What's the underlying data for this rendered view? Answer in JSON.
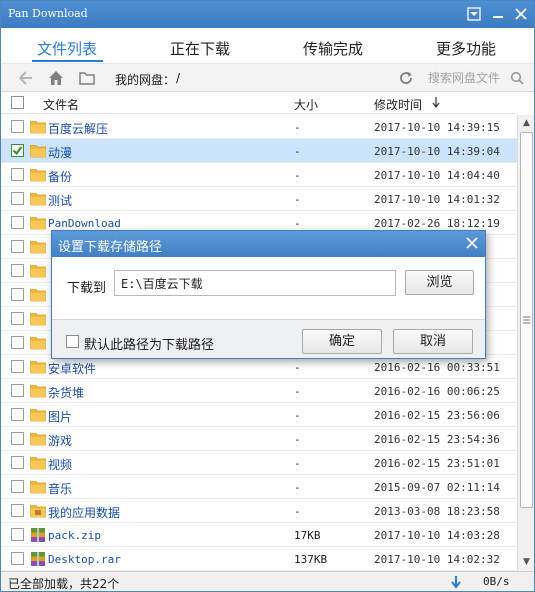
{
  "window": {
    "title": "Pan Download"
  },
  "tabs": [
    {
      "label": "文件列表",
      "active": true
    },
    {
      "label": "正在下载",
      "active": false
    },
    {
      "label": "传输完成",
      "active": false
    },
    {
      "label": "更多功能",
      "active": false
    }
  ],
  "toolbar": {
    "path_label": "我的网盘：",
    "path_value": "/",
    "search_placeholder": "搜索网盘文件"
  },
  "header": {
    "name": "文件名",
    "size": "大小",
    "modified": "修改时间"
  },
  "files": [
    {
      "name": "百度云解压",
      "size": "-",
      "time": "2017-10-10 14:39:15",
      "type": "folder",
      "checked": false
    },
    {
      "name": "动漫",
      "size": "-",
      "time": "2017-10-10 14:39:04",
      "type": "folder",
      "checked": true
    },
    {
      "name": "备份",
      "size": "-",
      "time": "2017-10-10 14:04:40",
      "type": "folder",
      "checked": false
    },
    {
      "name": "测试",
      "size": "-",
      "time": "2017-10-10 14:01:32",
      "type": "folder",
      "checked": false
    },
    {
      "name": "PanDownload",
      "size": "-",
      "time": "2017-02-26 18:12:19",
      "type": "folder",
      "checked": false
    },
    {
      "name": "",
      "size": "",
      "time": "",
      "type": "folder",
      "checked": false
    },
    {
      "name": "",
      "size": "",
      "time": "",
      "type": "folder",
      "checked": false
    },
    {
      "name": "",
      "size": "",
      "time": "",
      "type": "folder",
      "checked": false
    },
    {
      "name": "",
      "size": "",
      "time": "",
      "type": "folder",
      "checked": false
    },
    {
      "name": "",
      "size": "",
      "time": "",
      "type": "folder",
      "checked": false
    },
    {
      "name": "安卓软件",
      "size": "-",
      "time": "2016-02-16 00:33:51",
      "type": "folder",
      "checked": false
    },
    {
      "name": "杂货堆",
      "size": "-",
      "time": "2016-02-16 00:06:25",
      "type": "folder",
      "checked": false
    },
    {
      "name": "图片",
      "size": "-",
      "time": "2016-02-15 23:56:06",
      "type": "folder",
      "checked": false
    },
    {
      "name": "游戏",
      "size": "-",
      "time": "2016-02-15 23:54:36",
      "type": "folder",
      "checked": false
    },
    {
      "name": "视频",
      "size": "-",
      "time": "2016-02-15 23:51:01",
      "type": "folder",
      "checked": false
    },
    {
      "name": "音乐",
      "size": "-",
      "time": "2015-09-07 02:11:14",
      "type": "folder",
      "checked": false
    },
    {
      "name": "我的应用数据",
      "size": "-",
      "time": "2013-03-08 18:23:58",
      "type": "app-folder",
      "checked": false
    },
    {
      "name": "pack.zip",
      "size": "17KB",
      "time": "2017-10-10 14:03:28",
      "type": "archive",
      "checked": false
    },
    {
      "name": "Desktop.rar",
      "size": "137KB",
      "time": "2017-10-10 14:02:32",
      "type": "archive",
      "checked": false
    }
  ],
  "status": {
    "text": "已全部加载，共22个",
    "speed": "0B/s"
  },
  "dialog": {
    "title": "设置下载存储路径",
    "label": "下载到",
    "path": "E:\\百度云下载",
    "browse": "浏览",
    "default_label": "默认此路径为下载路径",
    "confirm": "确定",
    "cancel": "取消"
  },
  "colors": {
    "accent": "#2d79d6",
    "titlebar": "#4e8fd3",
    "selected_row": "#cce4fb",
    "file_name": "#1a4ea8",
    "folder": "#f0b43c"
  }
}
